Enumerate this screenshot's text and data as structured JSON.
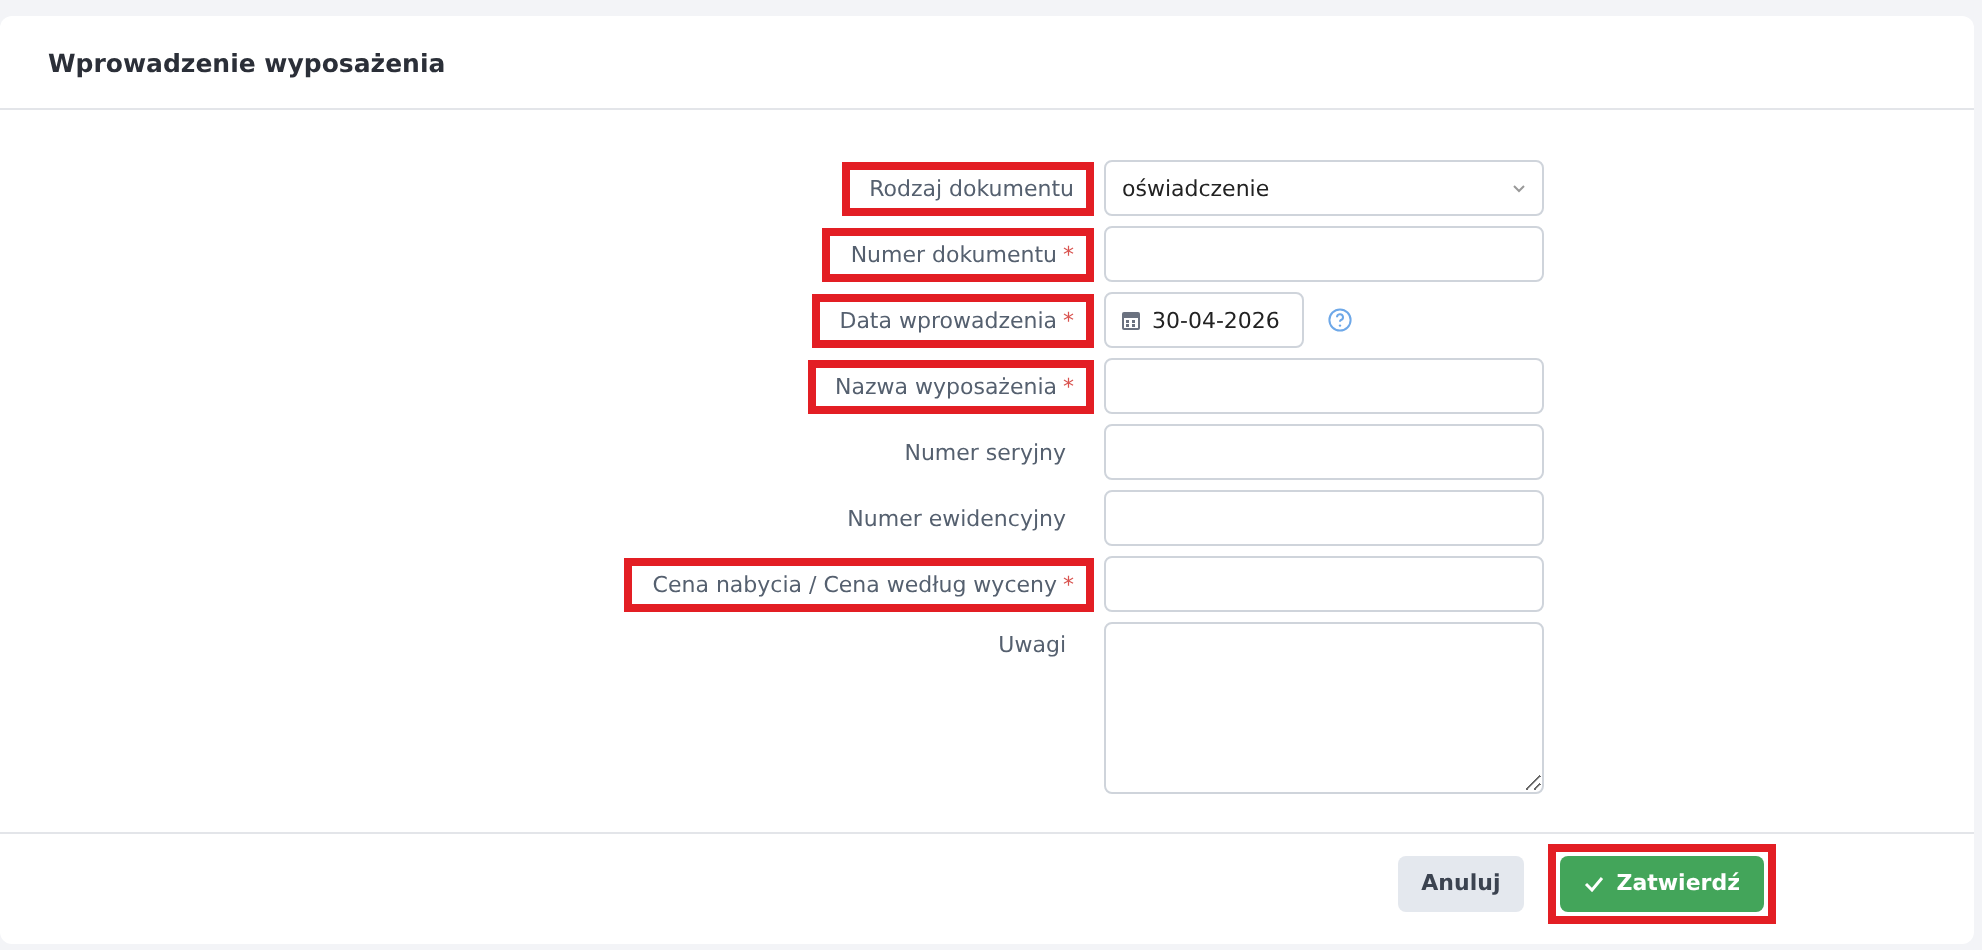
{
  "card": {
    "title": "Wprowadzenie wyposażenia"
  },
  "fields": [
    {
      "kind": "select",
      "label": "Rodzaj dokumentu",
      "value": "oświadczenie",
      "highlighted": true
    },
    {
      "kind": "text",
      "label": "Numer dokumentu",
      "required_mark": "*",
      "highlighted": true
    },
    {
      "kind": "date",
      "label": "Data wprowadzenia",
      "required_mark": "*",
      "value": "30-04-2026",
      "highlighted": true
    },
    {
      "kind": "text",
      "label": "Nazwa wyposażenia",
      "required_mark": "*",
      "highlighted": true
    },
    {
      "kind": "text",
      "label": "Numer seryjny",
      "highlighted": false
    },
    {
      "kind": "text",
      "label": "Numer ewidencyjny",
      "highlighted": false
    },
    {
      "kind": "text",
      "label": "Cena nabycia / Cena według wyceny",
      "required_mark": "*",
      "highlighted": true
    },
    {
      "kind": "textarea",
      "label": "Uwagi",
      "highlighted": false
    }
  ],
  "buttons": [
    {
      "kind": "cancel",
      "label": "Anuluj",
      "highlighted": false
    },
    {
      "kind": "confirm",
      "label": "Zatwierdź",
      "highlighted": true
    }
  ]
}
